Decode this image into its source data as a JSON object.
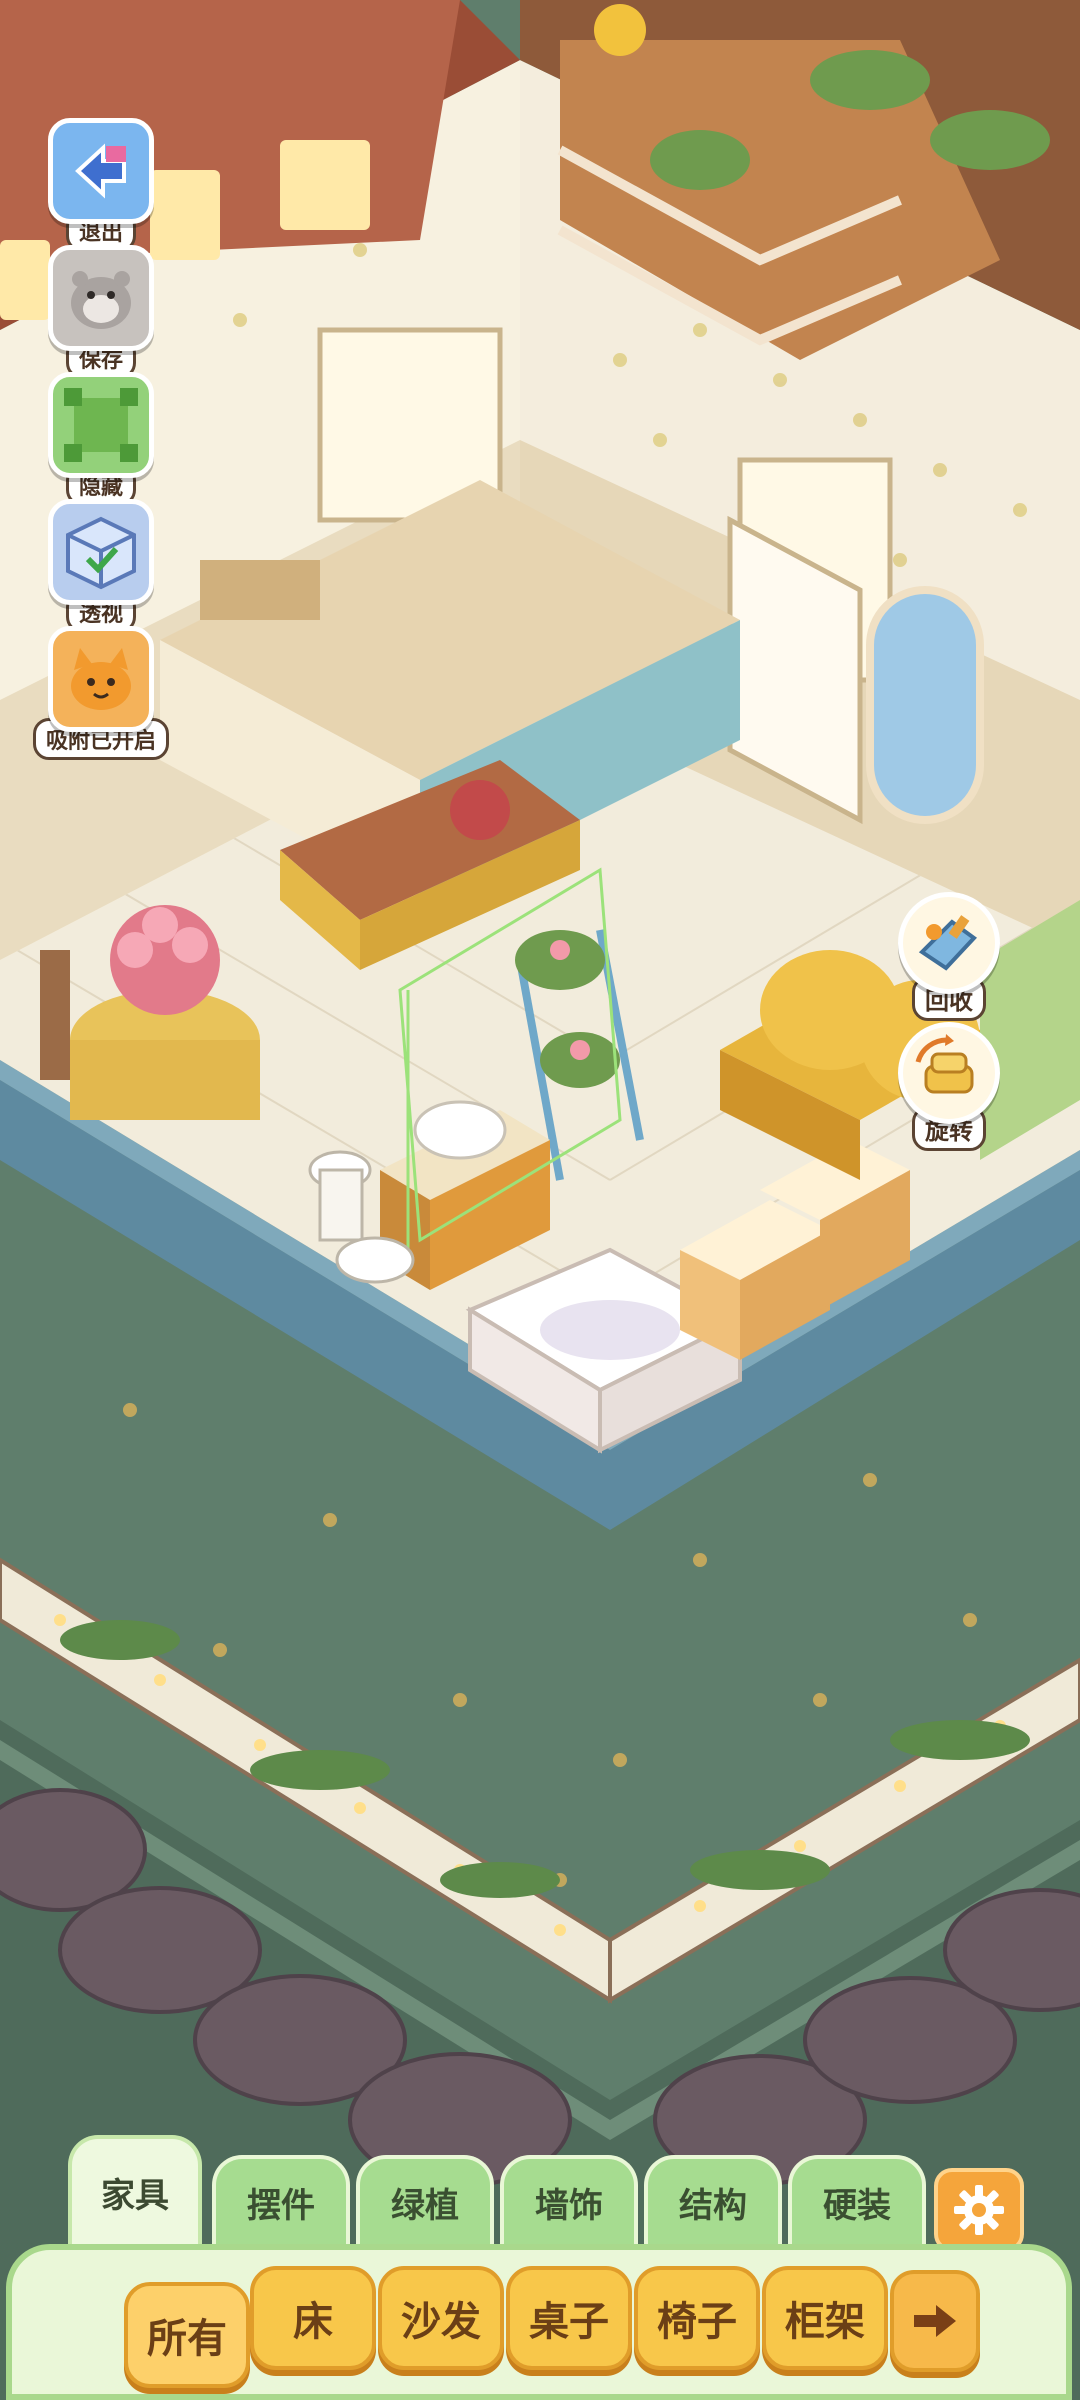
{
  "left_tools": [
    {
      "name": "exit",
      "label": "退出",
      "icon": "exit-arrow-icon",
      "color": "#7bb6ef"
    },
    {
      "name": "save",
      "label": "保存",
      "icon": "hamster-save-icon",
      "color": "#c7c2be"
    },
    {
      "name": "hide",
      "label": "隐藏",
      "icon": "hide-frame-icon",
      "color": "#93d17a"
    },
    {
      "name": "perspective",
      "label": "透视",
      "icon": "perspective-cube-icon",
      "color": "#b8cdee"
    },
    {
      "name": "snap",
      "label": "吸附已开启",
      "icon": "snap-magnet-cat-icon",
      "color": "#f4b25a"
    }
  ],
  "right_actions": [
    {
      "name": "recycle",
      "label": "回收",
      "icon": "recycle-dustpan-icon"
    },
    {
      "name": "rotate",
      "label": "旋转",
      "icon": "rotate-sofa-icon"
    }
  ],
  "category_tabs": [
    "家具",
    "摆件",
    "绿植",
    "墙饰",
    "结构",
    "硬装"
  ],
  "active_category": "家具",
  "furniture_subtabs": [
    "所有",
    "床",
    "沙发",
    "桌子",
    "椅子",
    "柜架"
  ],
  "active_subtab": "所有",
  "icons": {
    "settings": "gear-icon",
    "next": "right-arrow-icon"
  },
  "colors": {
    "grass": "#5f7e6c",
    "floor": "#f2ecdc",
    "wall_trim": "#5e8aa0",
    "tab_green": "#a6dc90",
    "button_orange": "#f8c74a"
  }
}
